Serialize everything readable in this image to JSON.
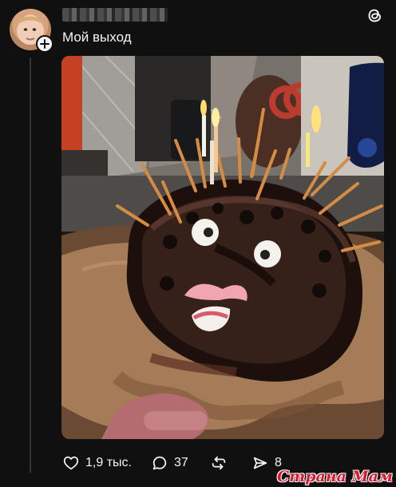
{
  "post": {
    "caption": "Мой выход",
    "username_blurred": true
  },
  "actions": {
    "likes": "1,9 тыс.",
    "comments": "37",
    "reposts": "",
    "shares": "8"
  },
  "icons": {
    "brand": "threads-icon",
    "follow": "plus-icon",
    "like": "heart-icon",
    "comment": "comment-icon",
    "repost": "repost-icon",
    "share": "share-icon"
  },
  "watermark": {
    "text": "Страна Мам"
  },
  "colors": {
    "background": "#101010",
    "text": "#f3f5f7",
    "thread_line": "#333638",
    "watermark": "#d71930"
  }
}
